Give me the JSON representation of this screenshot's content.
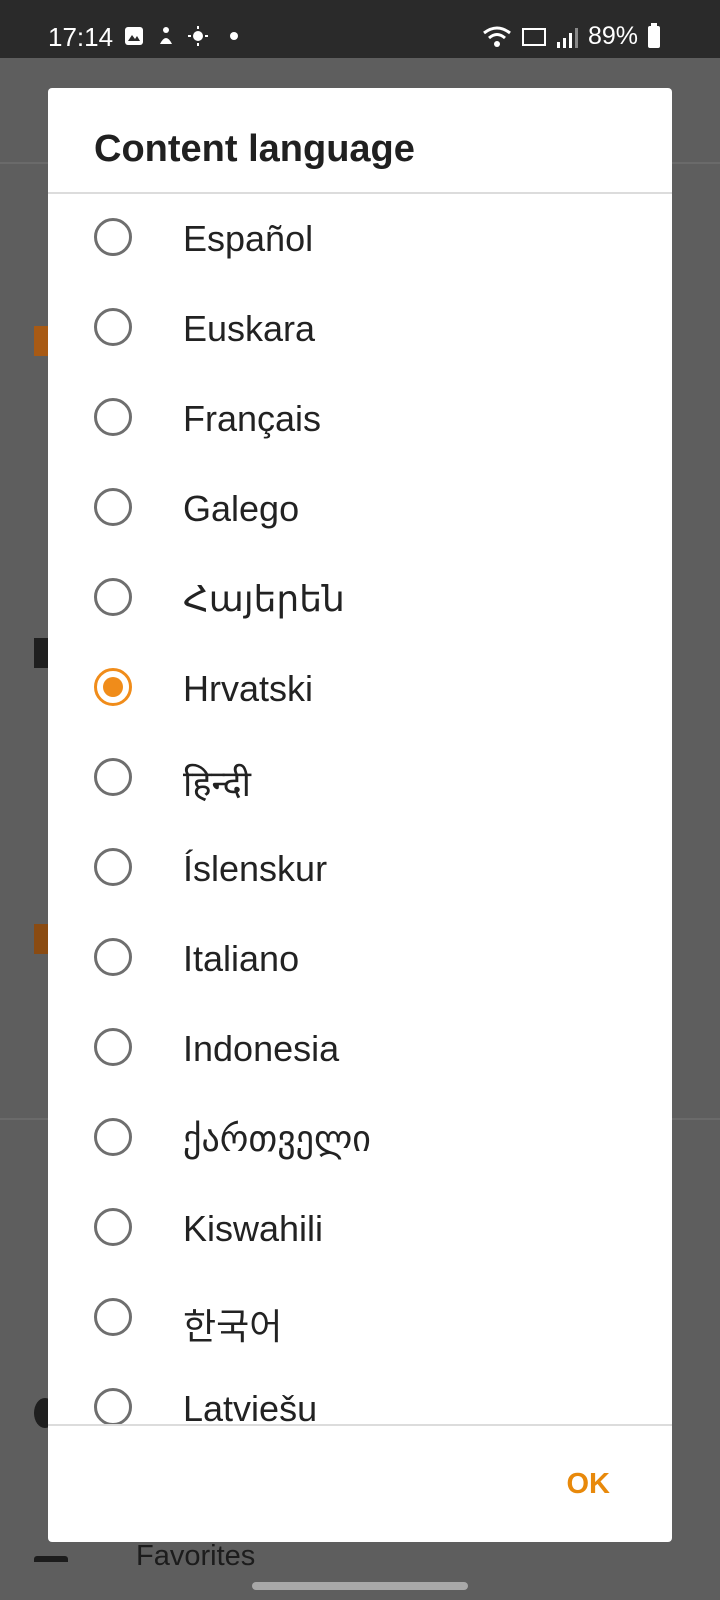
{
  "status_bar": {
    "time": "17:14",
    "battery": "89%"
  },
  "background": {
    "favorites_label": "Favorites"
  },
  "dialog": {
    "title": "Content language",
    "ok_label": "OK",
    "selected": "Hrvatski",
    "accent_color": "#f08c1a",
    "languages": [
      {
        "label": "Español",
        "checked": false
      },
      {
        "label": "Euskara",
        "checked": false
      },
      {
        "label": "Français",
        "checked": false
      },
      {
        "label": "Galego",
        "checked": false
      },
      {
        "label": "Հայերեն",
        "checked": false
      },
      {
        "label": "Hrvatski",
        "checked": true
      },
      {
        "label": "हिन्दी",
        "checked": false
      },
      {
        "label": "Íslenskur",
        "checked": false
      },
      {
        "label": "Italiano",
        "checked": false
      },
      {
        "label": "Indonesia",
        "checked": false
      },
      {
        "label": "ქართველი",
        "checked": false
      },
      {
        "label": "Kiswahili",
        "checked": false
      },
      {
        "label": "한국어",
        "checked": false
      },
      {
        "label": "Latviešu",
        "checked": false
      }
    ]
  }
}
